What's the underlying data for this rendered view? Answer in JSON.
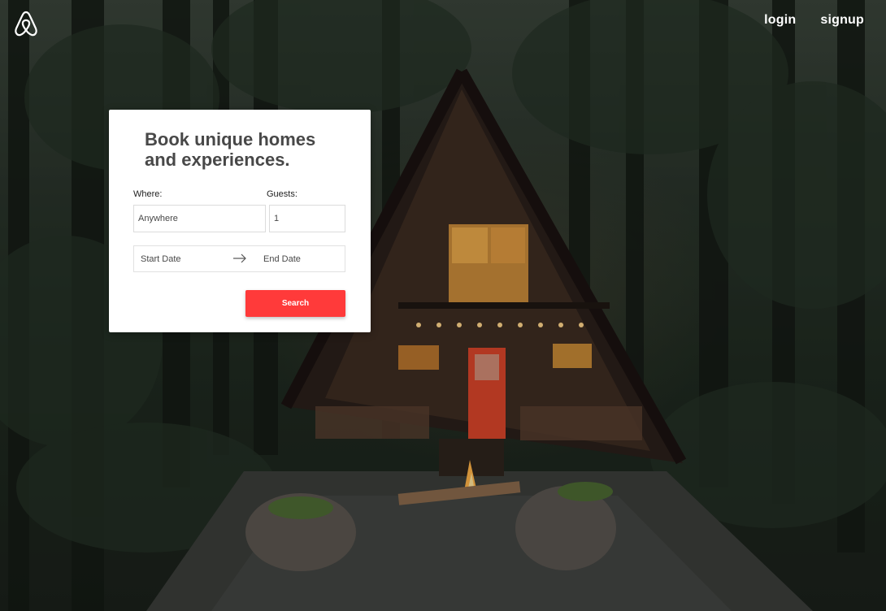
{
  "nav": {
    "logo_icon": "airbnb-belo-icon",
    "login": "login",
    "signup": "signup"
  },
  "card": {
    "title": "Book unique homes and experiences.",
    "where_label": "Where:",
    "where_placeholder": "Anywhere",
    "guests_label": "Guests:",
    "guests_value": "1",
    "start_date": "Start Date",
    "arrow_icon": "arrow-right-icon",
    "end_date": "End Date",
    "search_button": "Search"
  },
  "colors": {
    "accent": "#ff3a3a",
    "card_bg": "#ffffff",
    "title_text": "#484848",
    "nav_text": "#ffffff"
  }
}
